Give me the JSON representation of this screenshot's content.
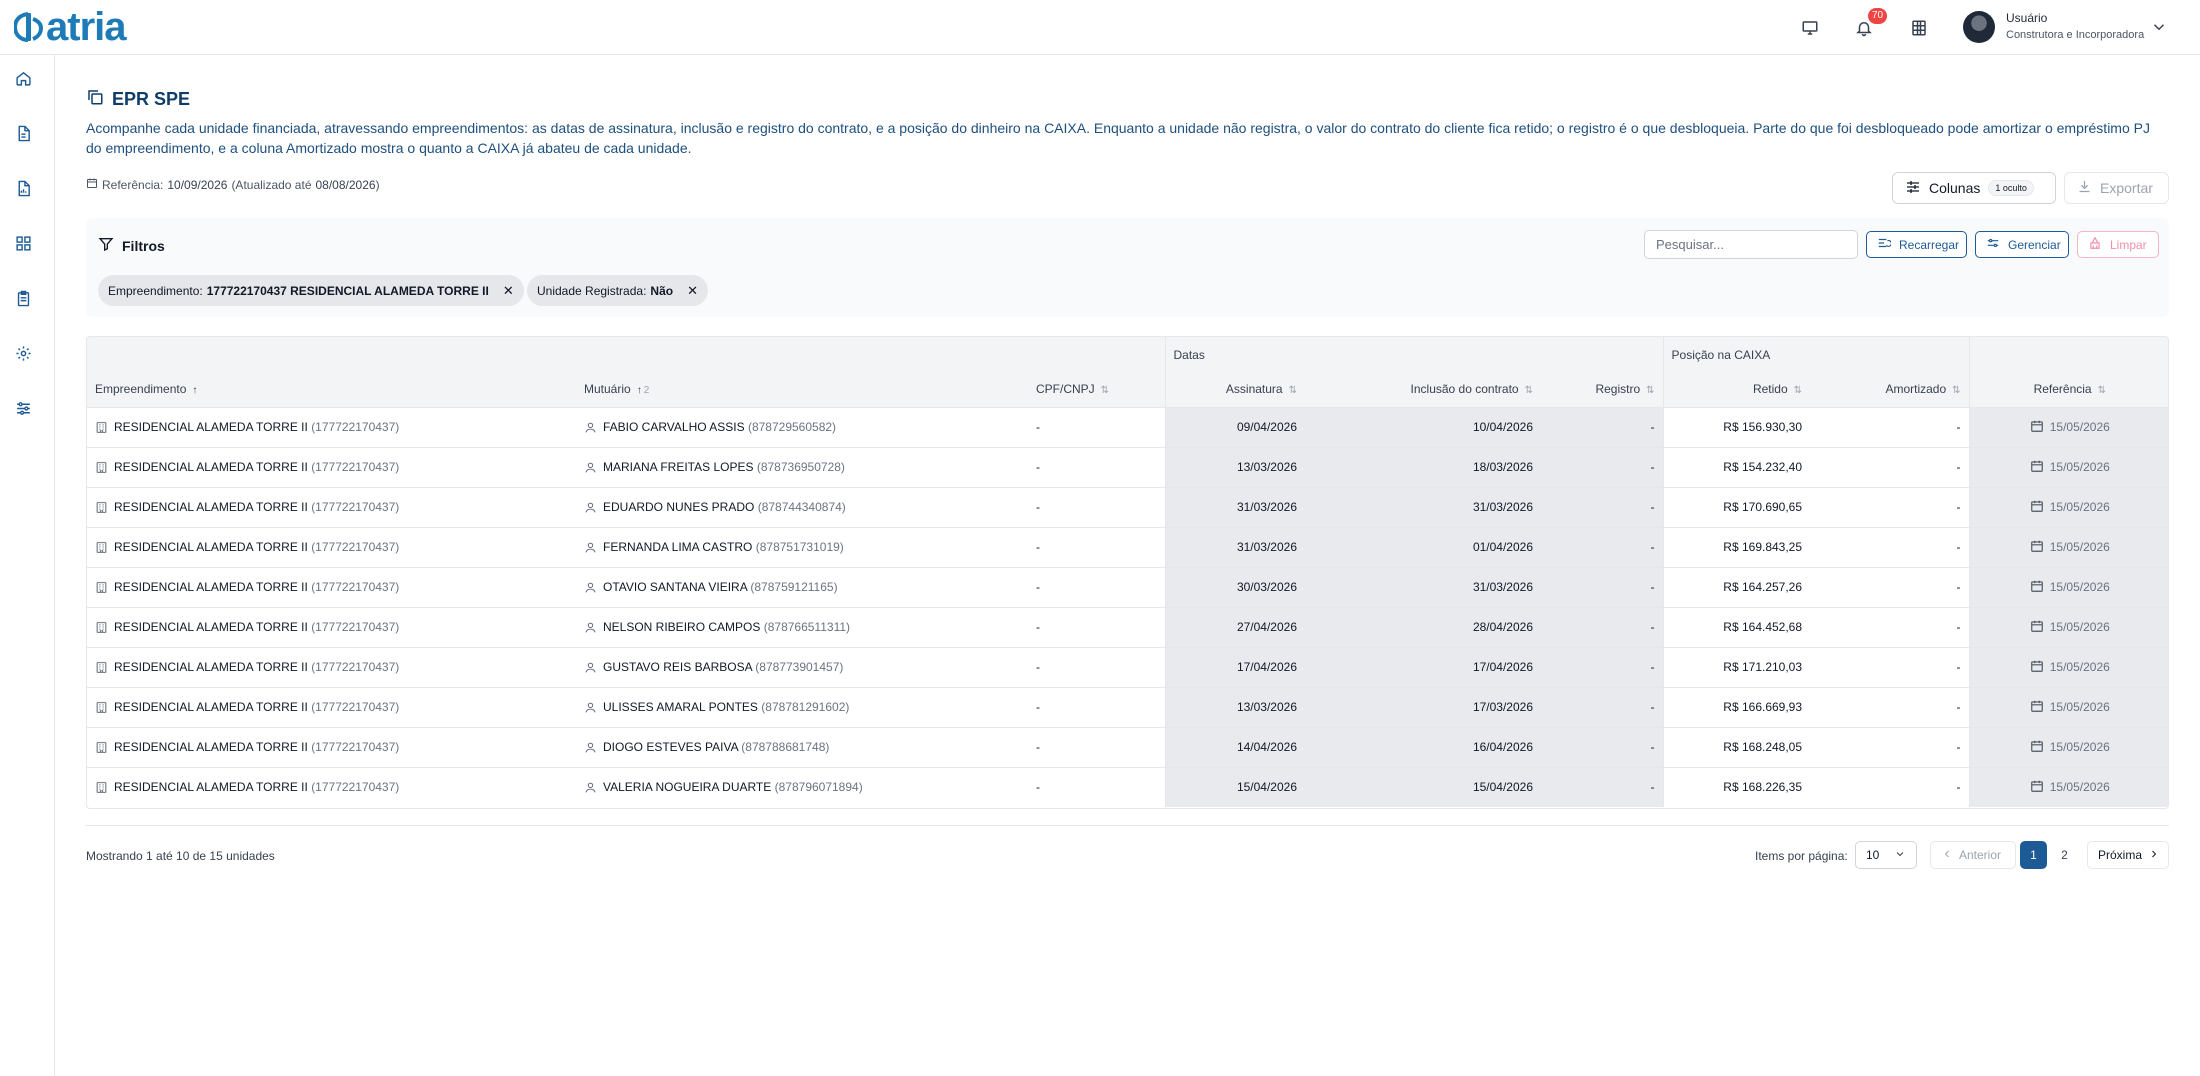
{
  "app": {
    "logo_text": "atria",
    "notifications_count": "70",
    "user_name": "Usuário",
    "user_company": "Construtora e Incorporadora"
  },
  "page": {
    "title": "EPR SPE",
    "description": "Acompanhe cada unidade financiada, atravessando empreendimentos: as datas de assinatura, inclusão e registro do contrato, e a posição do dinheiro na CAIXA. Enquanto a unidade não registra, o valor do contrato do cliente fica retido; o registro é o que desbloqueia. Parte do que foi desbloqueado pode amortizar o empréstimo PJ do empreendimento, e a coluna Amortizado mostra o quanto a CAIXA já abateu de cada unidade.",
    "reference_label": "Referência:",
    "reference_date": "10/09/2026",
    "updated_prefix": "(Atualizado até",
    "updated_date": "08/08/2026",
    "updated_suffix": ")"
  },
  "toolbar": {
    "columns_label": "Colunas",
    "columns_hidden": "1 oculto",
    "export_label": "Exportar"
  },
  "filters": {
    "title": "Filtros",
    "search_placeholder": "Pesquisar...",
    "reload_label": "Recarregar",
    "manage_label": "Gerenciar",
    "clear_label": "Limpar",
    "chips": [
      {
        "key": "Empreendimento:",
        "value": "177722170437 RESIDENCIAL ALAMEDA TORRE II"
      },
      {
        "key": "Unidade Registrada:",
        "value": "Não"
      }
    ]
  },
  "table": {
    "groups": {
      "datas": "Datas",
      "posicao": "Posição na CAIXA"
    },
    "columns": {
      "empreendimento": "Empreendimento",
      "mutuario": "Mutuário",
      "mutuario_sort_order": "2",
      "cpf": "CPF/CNPJ",
      "assinatura": "Assinatura",
      "inclusao": "Inclusão do contrato",
      "registro": "Registro",
      "retido": "Retido",
      "amortizado": "Amortizado",
      "referencia": "Referência"
    },
    "rows": [
      {
        "emp": "RESIDENCIAL ALAMEDA TORRE II",
        "emp_code": "(177722170437)",
        "mut": "FABIO CARVALHO ASSIS",
        "mut_code": "(878729560582)",
        "cpf": "-",
        "assinatura": "09/04/2026",
        "inclusao": "10/04/2026",
        "registro": "-",
        "retido": "R$ 156.930,30",
        "amortizado": "-",
        "referencia": "15/05/2026"
      },
      {
        "emp": "RESIDENCIAL ALAMEDA TORRE II",
        "emp_code": "(177722170437)",
        "mut": "MARIANA FREITAS LOPES",
        "mut_code": "(878736950728)",
        "cpf": "-",
        "assinatura": "13/03/2026",
        "inclusao": "18/03/2026",
        "registro": "-",
        "retido": "R$ 154.232,40",
        "amortizado": "-",
        "referencia": "15/05/2026"
      },
      {
        "emp": "RESIDENCIAL ALAMEDA TORRE II",
        "emp_code": "(177722170437)",
        "mut": "EDUARDO NUNES PRADO",
        "mut_code": "(878744340874)",
        "cpf": "-",
        "assinatura": "31/03/2026",
        "inclusao": "31/03/2026",
        "registro": "-",
        "retido": "R$ 170.690,65",
        "amortizado": "-",
        "referencia": "15/05/2026"
      },
      {
        "emp": "RESIDENCIAL ALAMEDA TORRE II",
        "emp_code": "(177722170437)",
        "mut": "FERNANDA LIMA CASTRO",
        "mut_code": "(878751731019)",
        "cpf": "-",
        "assinatura": "31/03/2026",
        "inclusao": "01/04/2026",
        "registro": "-",
        "retido": "R$ 169.843,25",
        "amortizado": "-",
        "referencia": "15/05/2026"
      },
      {
        "emp": "RESIDENCIAL ALAMEDA TORRE II",
        "emp_code": "(177722170437)",
        "mut": "OTAVIO SANTANA VIEIRA",
        "mut_code": "(878759121165)",
        "cpf": "-",
        "assinatura": "30/03/2026",
        "inclusao": "31/03/2026",
        "registro": "-",
        "retido": "R$ 164.257,26",
        "amortizado": "-",
        "referencia": "15/05/2026"
      },
      {
        "emp": "RESIDENCIAL ALAMEDA TORRE II",
        "emp_code": "(177722170437)",
        "mut": "NELSON RIBEIRO CAMPOS",
        "mut_code": "(878766511311)",
        "cpf": "-",
        "assinatura": "27/04/2026",
        "inclusao": "28/04/2026",
        "registro": "-",
        "retido": "R$ 164.452,68",
        "amortizado": "-",
        "referencia": "15/05/2026"
      },
      {
        "emp": "RESIDENCIAL ALAMEDA TORRE II",
        "emp_code": "(177722170437)",
        "mut": "GUSTAVO REIS BARBOSA",
        "mut_code": "(878773901457)",
        "cpf": "-",
        "assinatura": "17/04/2026",
        "inclusao": "17/04/2026",
        "registro": "-",
        "retido": "R$ 171.210,03",
        "amortizado": "-",
        "referencia": "15/05/2026"
      },
      {
        "emp": "RESIDENCIAL ALAMEDA TORRE II",
        "emp_code": "(177722170437)",
        "mut": "ULISSES AMARAL PONTES",
        "mut_code": "(878781291602)",
        "cpf": "-",
        "assinatura": "13/03/2026",
        "inclusao": "17/03/2026",
        "registro": "-",
        "retido": "R$ 166.669,93",
        "amortizado": "-",
        "referencia": "15/05/2026"
      },
      {
        "emp": "RESIDENCIAL ALAMEDA TORRE II",
        "emp_code": "(177722170437)",
        "mut": "DIOGO ESTEVES PAIVA",
        "mut_code": "(878788681748)",
        "cpf": "-",
        "assinatura": "14/04/2026",
        "inclusao": "16/04/2026",
        "registro": "-",
        "retido": "R$ 168.248,05",
        "amortizado": "-",
        "referencia": "15/05/2026"
      },
      {
        "emp": "RESIDENCIAL ALAMEDA TORRE II",
        "emp_code": "(177722170437)",
        "mut": "VALERIA NOGUEIRA DUARTE",
        "mut_code": "(878796071894)",
        "cpf": "-",
        "assinatura": "15/04/2026",
        "inclusao": "15/04/2026",
        "registro": "-",
        "retido": "R$ 168.226,35",
        "amortizado": "-",
        "referencia": "15/05/2026"
      }
    ]
  },
  "pagination": {
    "showing": "Mostrando 1 até 10 de 15 unidades",
    "per_page_label": "Items por página:",
    "per_page_value": "10",
    "prev_label": "Anterior",
    "next_label": "Próxima",
    "pages": [
      "1",
      "2"
    ]
  },
  "colors": {
    "brand": "#1f7bb8",
    "primary": "#1e5a96",
    "danger_soft": "#f08fa8"
  }
}
